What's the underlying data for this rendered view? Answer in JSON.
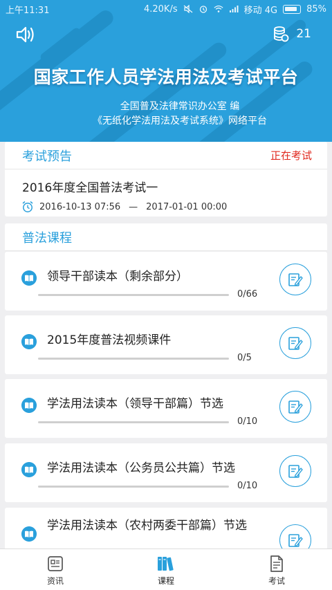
{
  "status_bar": {
    "time": "上午11:31",
    "speed": "4.20K/s",
    "carrier": "移动 4G",
    "battery": "85%"
  },
  "header": {
    "sound_icon": "speaker-icon",
    "coin_icon": "coins-icon",
    "coin_count": "21",
    "title": "国家工作人员学法用法及考试平台",
    "subtitle_1": "全国普及法律常识办公室 编",
    "subtitle_2": "《无纸化学法用法及考试系统》网络平台",
    "colors": {
      "primary": "#2aa0dc",
      "stripe": "#2190c9"
    }
  },
  "exam_preview": {
    "section_title": "考试预告",
    "status": "正在考试",
    "status_color": "#e0281e",
    "exam_name": "2016年度全国普法考试一",
    "time_icon": "alarm-clock-icon",
    "start": "2016-10-13 07:56",
    "separator": "—",
    "end": "2017-01-01 00:00"
  },
  "courses": {
    "section_title": "普法课程",
    "items": [
      {
        "name": "领导干部读本（剩余部分）",
        "count": "0/66",
        "progress": 0
      },
      {
        "name": "2015年度普法视频课件",
        "count": "0/5",
        "progress": 0
      },
      {
        "name": "学法用法读本（领导干部篇）节选",
        "count": "0/10",
        "progress": 0
      },
      {
        "name": "学法用法读本（公务员公共篇）节选",
        "count": "0/10",
        "progress": 0
      },
      {
        "name": "学法用法读本（农村两委干部篇）节选",
        "count": "",
        "progress": 0
      }
    ]
  },
  "tabbar": {
    "items": [
      {
        "label": "资讯",
        "icon": "news-icon",
        "active": false
      },
      {
        "label": "课程",
        "icon": "books-icon",
        "active": true
      },
      {
        "label": "考试",
        "icon": "exam-paper-icon",
        "active": false
      }
    ]
  }
}
